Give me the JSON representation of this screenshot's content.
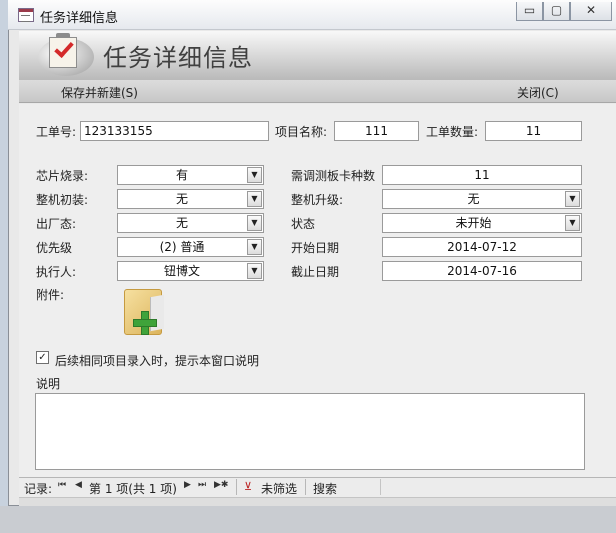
{
  "window": {
    "title": "任务详细信息",
    "controls": {
      "minimize": "▭",
      "maximize": "▢",
      "close": "✕"
    }
  },
  "header": {
    "title": "任务详细信息",
    "icon": "clipboard-check-icon"
  },
  "toolbar": {
    "save_new": "保存并新建(S)",
    "close": "关闭(C)"
  },
  "form": {
    "work_order": {
      "label": "工单号:",
      "value": "123133155"
    },
    "project_name": {
      "label": "项目名称:",
      "value": "111"
    },
    "order_qty": {
      "label": "工单数量:",
      "value": "11"
    },
    "chip_burn": {
      "label": "芯片烧录:",
      "value": "有"
    },
    "board_types": {
      "label": "需调测板卡种数",
      "value": "11"
    },
    "initial_install": {
      "label": "整机初装:",
      "value": "无"
    },
    "upgrade": {
      "label": "整机升级:",
      "value": "无"
    },
    "factory_state": {
      "label": "出厂态:",
      "value": "无"
    },
    "status": {
      "label": "状态",
      "value": "未开始"
    },
    "priority": {
      "label": "优先级",
      "value": "(2) 普通"
    },
    "start_date": {
      "label": "开始日期",
      "value": "2014-07-12"
    },
    "assignee": {
      "label": "执行人:",
      "value": "钮博文"
    },
    "due_date": {
      "label": "截止日期",
      "value": "2014-07-16"
    },
    "attachment": {
      "label": "附件:",
      "icon": "folder-add-icon"
    },
    "remind": {
      "label": "后续相同项目录入时，提示本窗口说明",
      "checked": true,
      "mark": "✓"
    },
    "description": {
      "label": "说明",
      "value": ""
    }
  },
  "navbar": {
    "record_label": "记录:",
    "first": "⏮",
    "prev": "◀",
    "position": "第 1 项(共 1 项)",
    "next": "▶",
    "last": "⏭",
    "new": "▶✱",
    "filter_icon": "funnel-x-icon",
    "filter_glyph": "⊻",
    "filter": "未筛选",
    "search": "搜索"
  }
}
